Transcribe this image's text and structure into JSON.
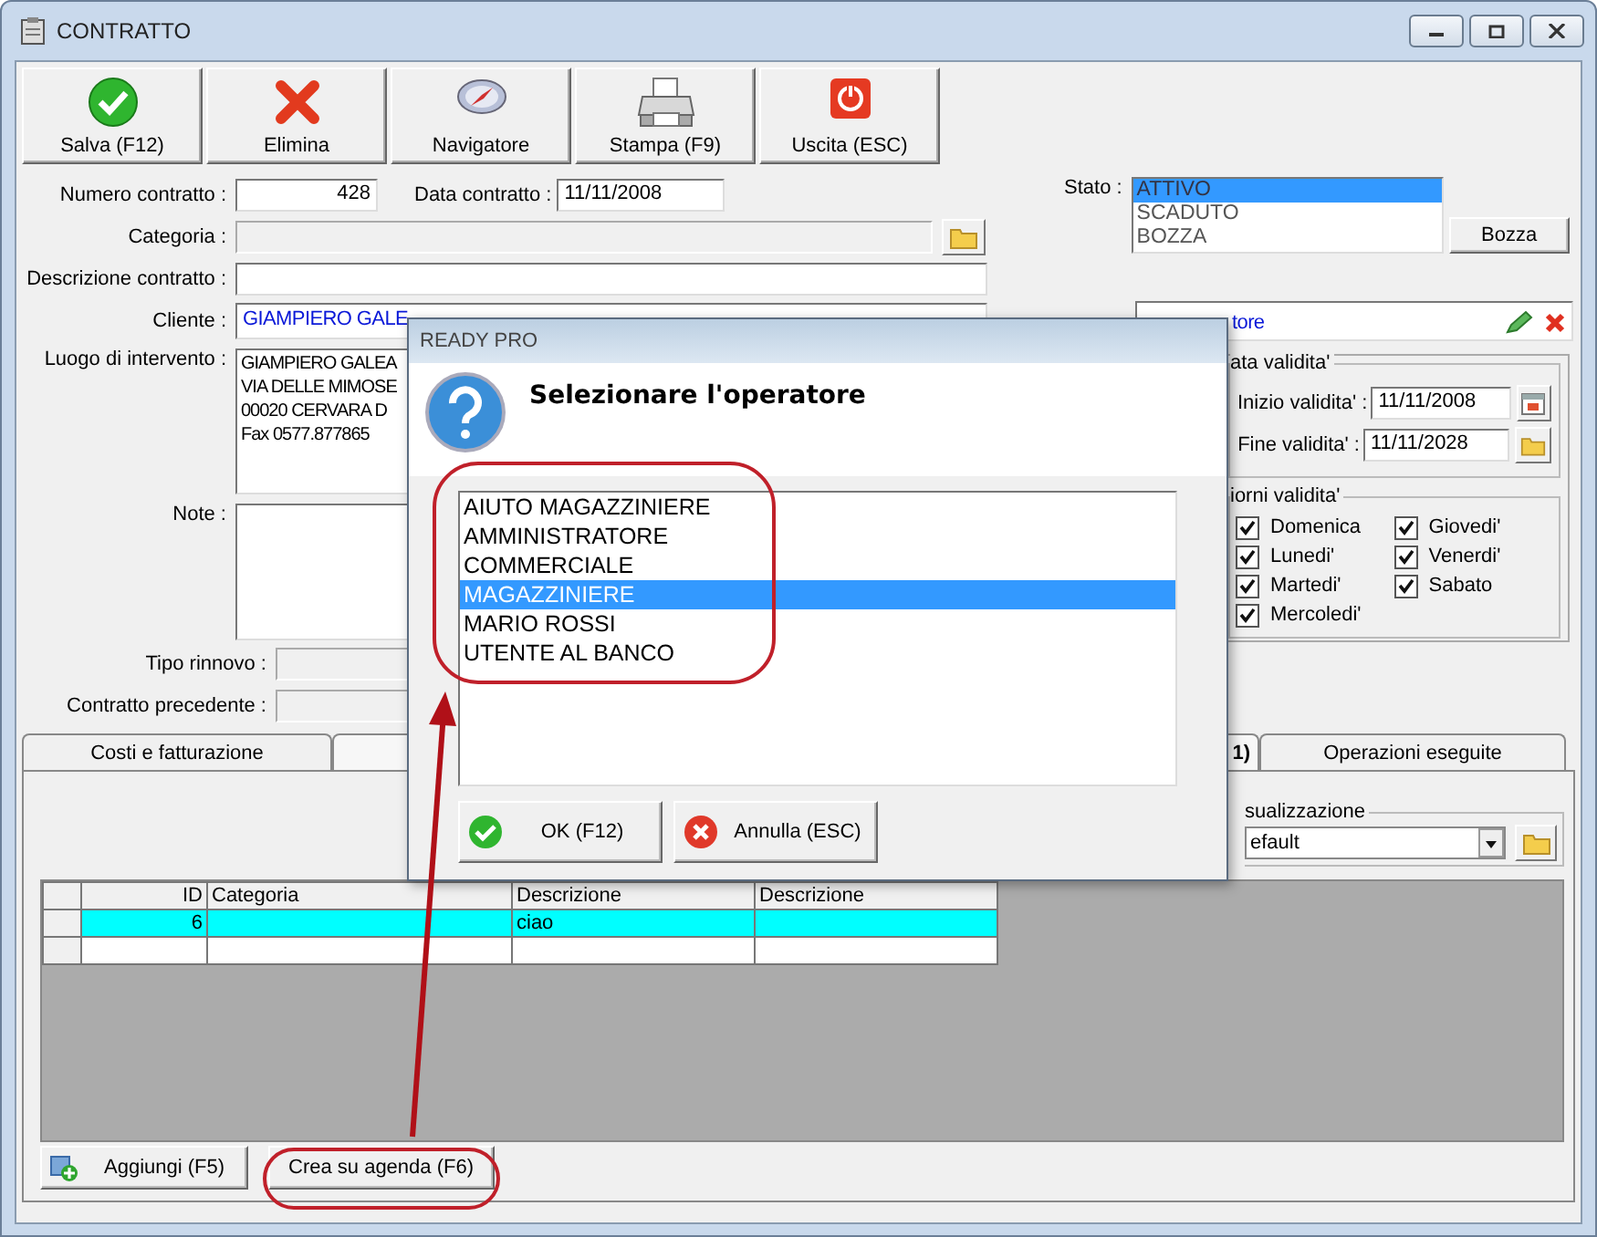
{
  "window": {
    "title": "CONTRATTO"
  },
  "toolbar": [
    {
      "label": "Salva (F12)",
      "kind": "save"
    },
    {
      "label": "Elimina",
      "kind": "delete"
    },
    {
      "label": "Navigatore",
      "kind": "navigator"
    },
    {
      "label": "Stampa (F9)",
      "kind": "print"
    },
    {
      "label": "Uscita (ESC)",
      "kind": "exit"
    }
  ],
  "form": {
    "numero_contratto": {
      "label": "Numero contratto :",
      "value": "428"
    },
    "data_contratto": {
      "label": "Data contratto :",
      "value": "11/11/2008"
    },
    "categoria": {
      "label": "Categoria :"
    },
    "descrizione": {
      "label": "Descrizione contratto :"
    },
    "cliente": {
      "label": "Cliente :",
      "value": "GIAMPIERO GALE"
    },
    "luogo": {
      "label": "Luogo di intervento :",
      "lines": [
        "GIAMPIERO GALEA",
        "VIA DELLE MIMOSE",
        "00020 CERVARA D",
        "Fax 0577.877865"
      ]
    },
    "note": {
      "label": "Note :"
    },
    "tipo_rinnovo": {
      "label": "Tipo rinnovo :"
    },
    "contratto_precedente": {
      "label": "Contratto precedente :"
    }
  },
  "stato": {
    "label": "Stato :",
    "options": [
      {
        "label": "ATTIVO",
        "selected": true
      },
      {
        "label": "SCADUTO",
        "selected": false
      },
      {
        "label": "BOZZA",
        "selected": false
      }
    ]
  },
  "bozza_button": "Bozza",
  "referente": {
    "value": "tore"
  },
  "data_validita": {
    "title": "ata validita'",
    "inizio": {
      "label": "Inizio validita' :",
      "value": "11/11/2008"
    },
    "fine": {
      "label": "Fine validita' :",
      "value": "11/11/2028"
    }
  },
  "giorni_validita": {
    "title": "iorni validita'",
    "days": [
      {
        "label": "Domenica",
        "checked": true
      },
      {
        "label": "Lunedi'",
        "checked": true
      },
      {
        "label": "Martedi'",
        "checked": true
      },
      {
        "label": "Mercoledi'",
        "checked": true
      },
      {
        "label": "Giovedi'",
        "checked": true
      },
      {
        "label": "Venerdi'",
        "checked": true
      },
      {
        "label": "Sabato",
        "checked": true
      }
    ]
  },
  "tabs": [
    {
      "label": "Costi e fatturazione",
      "selected": false
    },
    {
      "label": "1)",
      "selected": true
    },
    {
      "label": "Operazioni eseguite",
      "selected": false
    }
  ],
  "visualizzazione": {
    "title": "sualizzazione",
    "value": "efault"
  },
  "table": {
    "columns": [
      "ID",
      "Categoria",
      "Descrizione",
      "Descrizione"
    ],
    "rows": [
      {
        "id": "6",
        "description": "ciao",
        "selected": true
      },
      {
        "selected": false
      }
    ]
  },
  "bottom_buttons": [
    {
      "label": "Aggiungi (F5)",
      "kind": "add"
    },
    {
      "label": "Crea su agenda (F6)",
      "kind": "plain"
    }
  ],
  "dialog": {
    "title": "READY PRO",
    "heading": "Selezionare l'operatore",
    "operators": [
      {
        "name": "AIUTO MAGAZZINIERE",
        "selected": false
      },
      {
        "name": "AMMINISTRATORE",
        "selected": false
      },
      {
        "name": "COMMERCIALE",
        "selected": false
      },
      {
        "name": "MAGAZZINIERE",
        "selected": true
      },
      {
        "name": "MARIO ROSSI",
        "selected": false
      },
      {
        "name": "UTENTE AL BANCO",
        "selected": false
      }
    ],
    "buttons": [
      {
        "label": "OK (F12)",
        "kind": "ok"
      },
      {
        "label": "Annulla (ESC)",
        "kind": "cancel"
      }
    ]
  }
}
